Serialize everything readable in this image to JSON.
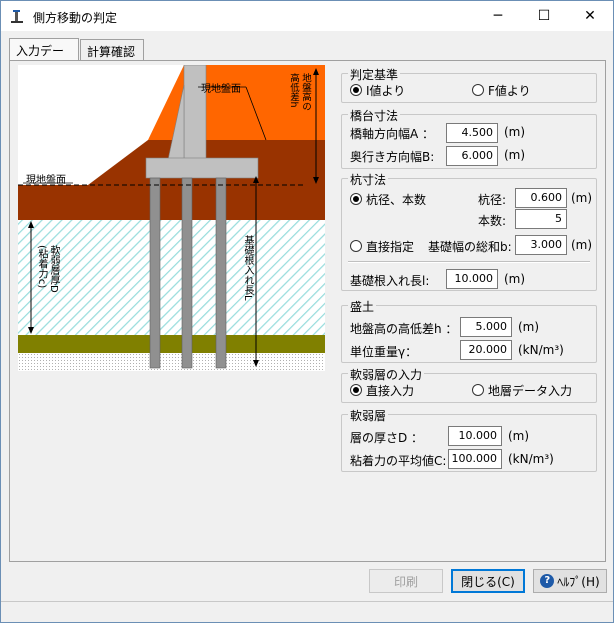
{
  "window": {
    "title": "側方移動の判定",
    "minimize": "─",
    "maximize": "☐",
    "close": "✕"
  },
  "tabs": [
    {
      "label": "入力データ"
    },
    {
      "label": "計算確認"
    }
  ],
  "diagram": {
    "ground_surface_top": "現地盤面",
    "ground_surface_left": "現地盤面",
    "height_diff_label": "地盤高の\n高低差h",
    "soft_layer_label": "軟弱層厚D\n(粘着力c)",
    "embed_label": "基礎根入れ長L"
  },
  "criteria": {
    "title": "判定基準",
    "option_i": "I値より",
    "option_f": "F値より"
  },
  "abutment": {
    "title": "橋台寸法",
    "width_label": "橋軸方向幅A ：",
    "width_value": "4.500",
    "width_unit": "(m)",
    "depth_label": "奥行き方向幅B:",
    "depth_value": "6.000",
    "depth_unit": "(m)"
  },
  "pile": {
    "title": "杭寸法",
    "option_dia": "杭径、本数",
    "dia_label": "杭径:",
    "dia_value": "0.600",
    "dia_unit": "(m)",
    "count_label": "本数:",
    "count_value": "5",
    "option_direct": "直接指定",
    "total_width_label": "基礎幅の総和b:",
    "total_width_value": "3.000",
    "total_width_unit": "(m)",
    "embed_label": "基礎根入れ長l:",
    "embed_value": "10.000",
    "embed_unit": "(m)"
  },
  "fill": {
    "title": "盛土",
    "height_label": "地盤高の高低差h ：",
    "height_value": "5.000",
    "height_unit": "(m)",
    "weight_label": "単位重量γ：",
    "weight_value": "20.000",
    "weight_unit": "(kN/m³)"
  },
  "soft_input": {
    "title": "軟弱層の入力",
    "option_direct": "直接入力",
    "option_layer": "地層データ入力"
  },
  "soft_layer": {
    "title": "軟弱層",
    "thickness_label": "層の厚さD ：",
    "thickness_value": "10.000",
    "thickness_unit": "(m)",
    "cohesion_label": "粘着力の平均値C:",
    "cohesion_value": "100.000",
    "cohesion_unit": "(kN/m³)"
  },
  "buttons": {
    "print": "印刷",
    "close": "閉じる(C)",
    "help": "ﾍﾙﾌﾟ(H)"
  },
  "colors": {
    "fill_orange": "#ff6600",
    "soil_brown": "#993300",
    "clay_olive": "#808000",
    "soft_hatch": "#99dddd",
    "concrete": "#c0c0c0"
  }
}
